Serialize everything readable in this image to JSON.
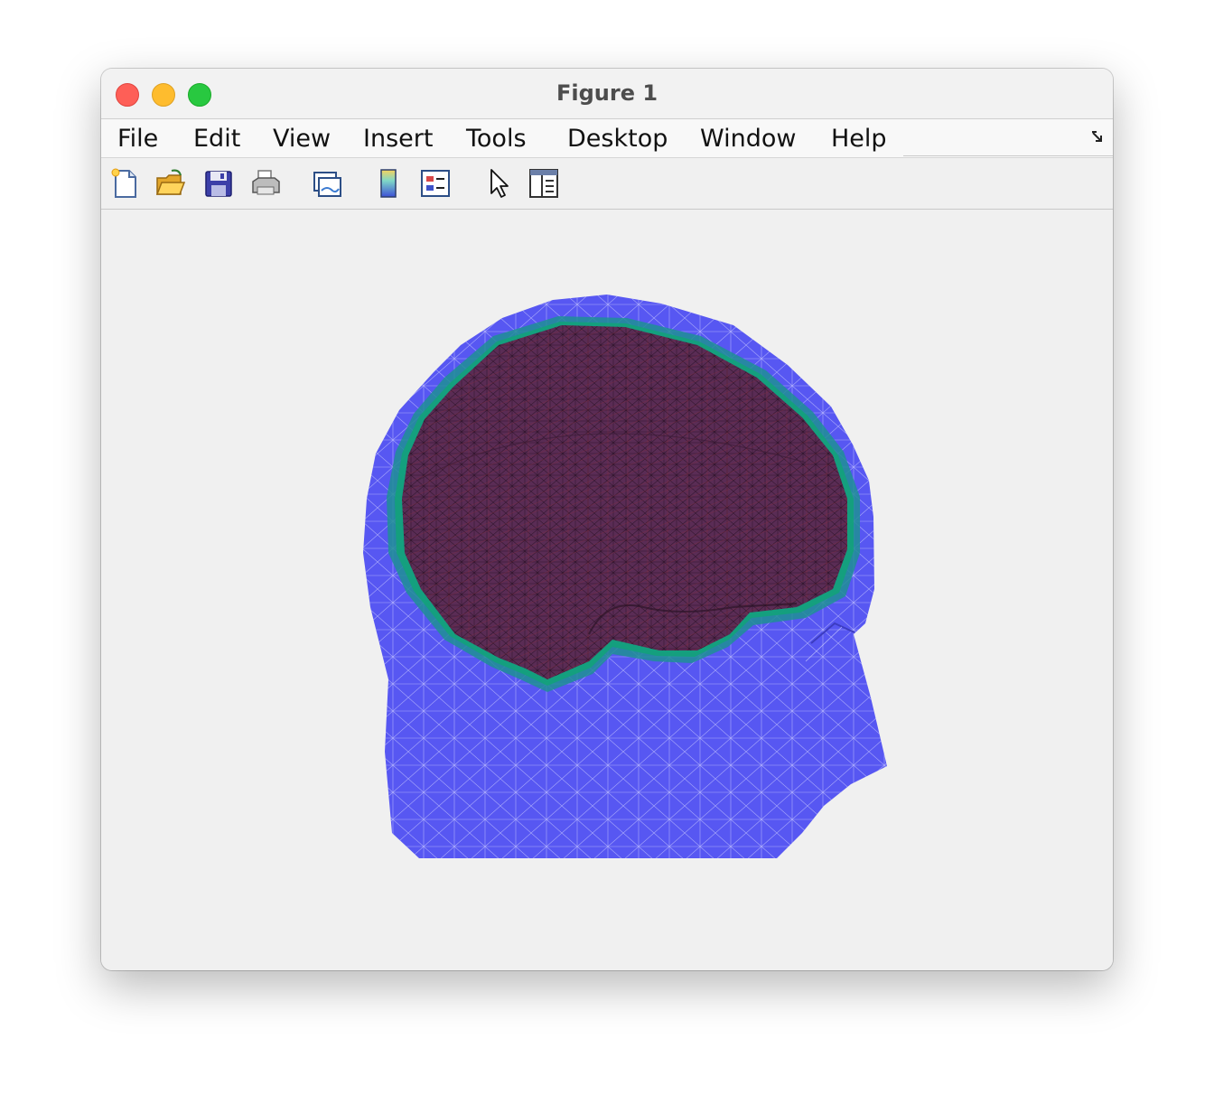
{
  "window": {
    "title": "Figure 1"
  },
  "menu": {
    "items": [
      {
        "label": "File"
      },
      {
        "label": "Edit"
      },
      {
        "label": "View"
      },
      {
        "label": "Insert"
      },
      {
        "label": "Tools"
      },
      {
        "label": "Desktop"
      },
      {
        "label": "Window"
      },
      {
        "label": "Help"
      }
    ]
  },
  "toolbar": {
    "buttons": [
      {
        "icon": "new-figure-icon"
      },
      {
        "icon": "open-file-icon"
      },
      {
        "icon": "save-icon"
      },
      {
        "icon": "print-icon"
      },
      {
        "icon": "link-plot-icon"
      },
      {
        "icon": "colorbar-icon"
      },
      {
        "icon": "legend-icon"
      },
      {
        "icon": "pointer-icon"
      },
      {
        "icon": "property-inspector-icon"
      }
    ]
  },
  "colors": {
    "scalp": "#5757f2",
    "skull": "#1a9a8c",
    "brain": "#5a2c55",
    "mesh_scalp": "#c8c8ff",
    "mesh_brain": "#3a1a30"
  }
}
